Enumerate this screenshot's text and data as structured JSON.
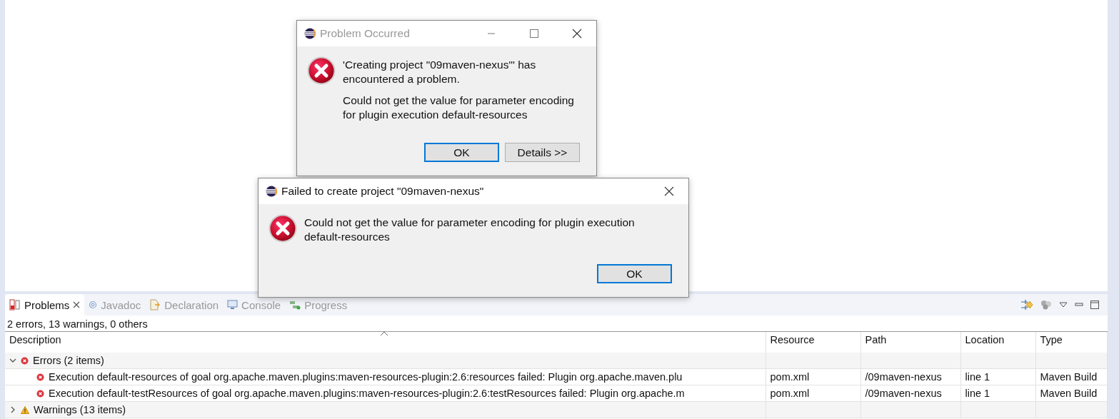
{
  "problems_view": {
    "tabs": [
      {
        "label": "Problems",
        "selected": true,
        "closable": true,
        "kind": "problems"
      },
      {
        "label": "Javadoc",
        "selected": false,
        "closable": false,
        "kind": "javadoc"
      },
      {
        "label": "Declaration",
        "selected": false,
        "closable": false,
        "kind": "declaration"
      },
      {
        "label": "Console",
        "selected": false,
        "closable": false,
        "kind": "console"
      },
      {
        "label": "Progress",
        "selected": false,
        "closable": false,
        "kind": "progress"
      }
    ],
    "summary": "2 errors, 13 warnings, 0 others",
    "table": {
      "columns": [
        "Description",
        "Resource",
        "Path",
        "Location",
        "Type"
      ],
      "rows": [
        {
          "kind": "error",
          "label": "Errors (2 items)",
          "expanded": true,
          "children": [
            {
              "kind": "error",
              "cells": [
                "Execution default-resources of goal org.apache.maven.plugins:maven-resources-plugin:2.6:resources failed: Plugin org.apache.maven.plu",
                "pom.xml",
                "/09maven-nexus",
                "line 1",
                "Maven Build"
              ]
            },
            {
              "kind": "error",
              "cells": [
                "Execution default-testResources of goal org.apache.maven.plugins:maven-resources-plugin:2.6:testResources failed: Plugin org.apache.m",
                "pom.xml",
                "/09maven-nexus",
                "line 1",
                "Maven Build"
              ]
            }
          ]
        },
        {
          "kind": "warning",
          "label": "Warnings (13 items)",
          "expanded": false
        }
      ]
    }
  },
  "dialogs": [
    {
      "title": "Problem Occurred",
      "active": false,
      "controls": [
        {
          "kind": "minimize"
        },
        {
          "kind": "maximize"
        },
        {
          "kind": "close"
        }
      ],
      "paragraphs": [
        "'Creating project \"09maven-nexus\"' has encountered a problem.",
        "Could not get the value for parameter encoding for plugin execution default-resources"
      ],
      "buttons": [
        {
          "label": "OK",
          "default": true
        },
        {
          "label": "Details >>",
          "default": false
        }
      ]
    },
    {
      "title": "Failed to create project \"09maven-nexus\"",
      "active": true,
      "controls": [
        {
          "kind": "close"
        }
      ],
      "paragraphs": [
        "Could not get the value for parameter encoding for plugin execution default-resources"
      ],
      "buttons": [
        {
          "label": "OK",
          "default": true
        }
      ]
    }
  ]
}
